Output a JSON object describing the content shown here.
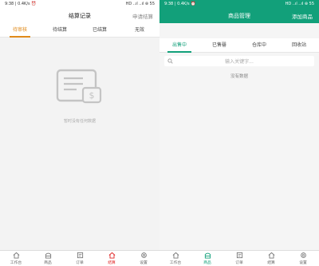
{
  "left": {
    "status_time": "9:38 | 0.4K/s ⏰",
    "status_right": "HD ..ıl ..ıl ⊛ 55",
    "title": "结算记录",
    "action": "申请结算",
    "tabs": [
      "待审核",
      "待结算",
      "已结算",
      "无效"
    ],
    "empty_text": "暂时没有任何数据",
    "nav": [
      "工作台",
      "商品",
      "订单",
      "结算",
      "设置"
    ]
  },
  "right": {
    "status_time": "9:38 | 0.4K/s ⏰",
    "status_right": "HD ..ıl ..ıl ⊛ 55",
    "title": "商品管理",
    "action": "添加商品",
    "tabs": [
      "出售中",
      "已售罄",
      "仓库中",
      "回收站"
    ],
    "search_placeholder": "输入关键字...",
    "no_data": "没有数据",
    "nav": [
      "工作台",
      "商品",
      "订单",
      "结算",
      "设置"
    ]
  },
  "colors": {
    "accent_orange": "#e08a1a",
    "accent_green": "#12a07a",
    "accent_red": "#e02424"
  }
}
